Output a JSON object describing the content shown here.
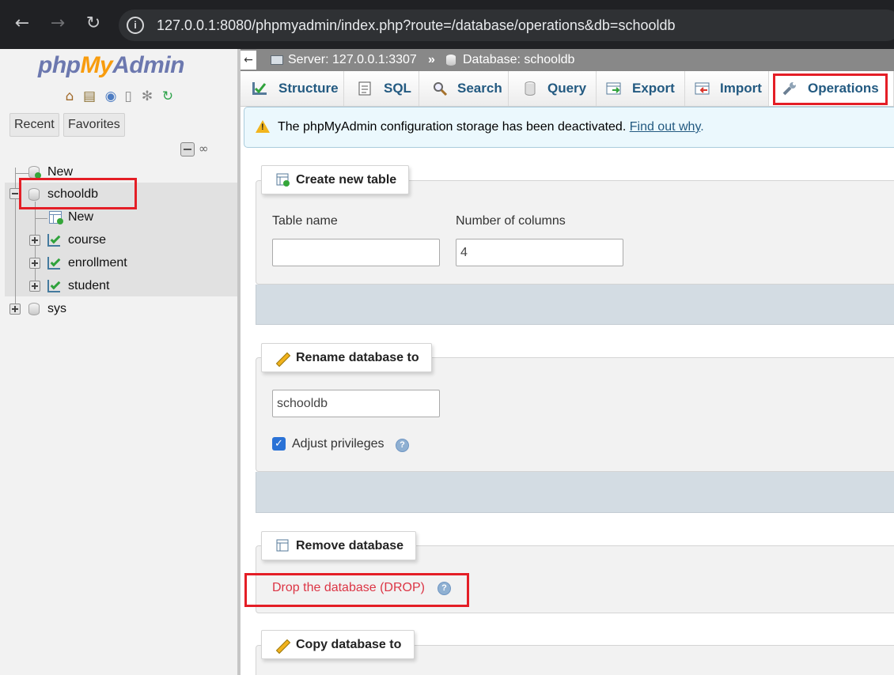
{
  "browser": {
    "back_icon": "←",
    "forward_icon": "→",
    "reload_icon": "↻",
    "info_icon": "i",
    "url": "127.0.0.1:8080/phpmyadmin/index.php?route=/database/operations&db=schooldb"
  },
  "sidebar": {
    "logo": {
      "php": "php",
      "my": "My",
      "admin": "Admin"
    },
    "quick_icons": [
      "home-icon",
      "exit-icon",
      "help-icon",
      "docs-icon",
      "settings-icon",
      "reload-icon"
    ],
    "tabs": [
      "Recent",
      "Favorites"
    ],
    "tree": {
      "new_label": "New",
      "databases": [
        {
          "name": "schooldb",
          "expanded": true,
          "children": [
            {
              "label": "New",
              "type": "new"
            },
            {
              "label": "course",
              "type": "table"
            },
            {
              "label": "enrollment",
              "type": "table"
            },
            {
              "label": "student",
              "type": "table"
            }
          ]
        },
        {
          "name": "sys",
          "expanded": false
        }
      ]
    }
  },
  "breadcrumb": {
    "server": "Server: 127.0.0.1:3307",
    "separator": "»",
    "database": "Database: schooldb"
  },
  "menu": {
    "tabs": [
      {
        "label": "Structure",
        "icon": "structure-icon"
      },
      {
        "label": "SQL",
        "icon": "sql-icon"
      },
      {
        "label": "Search",
        "icon": "search-icon"
      },
      {
        "label": "Query",
        "icon": "query-icon"
      },
      {
        "label": "Export",
        "icon": "export-icon"
      },
      {
        "label": "Import",
        "icon": "import-icon"
      },
      {
        "label": "Operations",
        "icon": "wrench-icon",
        "active": true
      }
    ]
  },
  "notice": {
    "text": "The phpMyAdmin configuration storage has been deactivated.",
    "link": "Find out why",
    "suffix": "."
  },
  "create_table": {
    "legend": "Create new table",
    "table_name_label": "Table name",
    "table_name_value": "",
    "columns_label": "Number of columns",
    "columns_value": "4"
  },
  "rename_db": {
    "legend": "Rename database to",
    "value": "schooldb",
    "adjust_label": "Adjust privileges",
    "adjust_checked": true
  },
  "remove_db": {
    "legend": "Remove database",
    "drop_link": "Drop the database (DROP)"
  },
  "copy_db": {
    "legend": "Copy database to"
  },
  "colors": {
    "accent": "#235a81",
    "drop": "#dc3545",
    "highlight_box": "#e41e26"
  }
}
